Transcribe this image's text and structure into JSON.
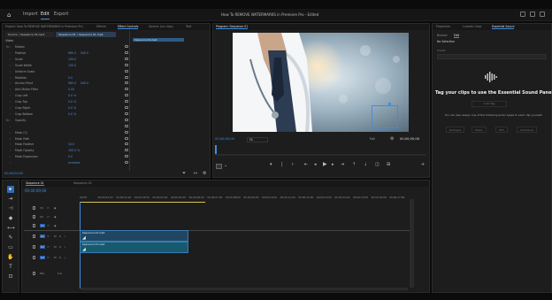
{
  "menu": {
    "home_icon": "home-icon",
    "items": [
      "Import",
      "Edit",
      "Export"
    ],
    "active": "Edit",
    "title": "How To REMOVE WATERMARKS in Premiere Pro - Edited"
  },
  "source_panel": {
    "tabs": [
      "Project: How To REMOVE WATERMARKS in Premiere Pro",
      "Effects",
      "Effect Controls",
      "Source: (no clips)",
      "Text"
    ],
    "source_label": "Source • Sequence 01.mp4",
    "seq_label": "Sequence 01 • Sequence 01.mp4",
    "section_video": "Video",
    "rows": [
      {
        "fx": "fx",
        "label": "Motion",
        "v1": "",
        "v2": ""
      },
      {
        "fx": "",
        "label": "Position",
        "v1": "960.0",
        "v2": "540.0"
      },
      {
        "fx": "",
        "label": "Scale",
        "v1": "100.0",
        "v2": ""
      },
      {
        "fx": "",
        "label": "Scale Width",
        "v1": "100.0",
        "v2": ""
      },
      {
        "fx": "",
        "label": "Uniform Scale",
        "v1": "",
        "v2": ""
      },
      {
        "fx": "",
        "label": "Rotation",
        "v1": "0.0",
        "v2": ""
      },
      {
        "fx": "",
        "label": "Anchor Point",
        "v1": "960.0",
        "v2": "540.0"
      },
      {
        "fx": "",
        "label": "Anti-flicker Filter",
        "v1": "0.00",
        "v2": ""
      },
      {
        "fx": "",
        "label": "Crop Left",
        "v1": "0.0 %",
        "v2": ""
      },
      {
        "fx": "",
        "label": "Crop Top",
        "v1": "0.0 %",
        "v2": ""
      },
      {
        "fx": "",
        "label": "Crop Right",
        "v1": "0.0 %",
        "v2": ""
      },
      {
        "fx": "",
        "label": "Crop Bottom",
        "v1": "0.0 %",
        "v2": ""
      },
      {
        "fx": "fx",
        "label": "Opacity",
        "v1": "",
        "v2": ""
      },
      {
        "fx": "",
        "label": "",
        "v1": "",
        "v2": ""
      },
      {
        "fx": "",
        "label": "Mask (1)",
        "v1": "",
        "v2": ""
      },
      {
        "fx": "",
        "label": "Mask Path",
        "v1": "",
        "v2": ""
      },
      {
        "fx": "",
        "label": "Mask Feather",
        "v1": "10.0",
        "v2": ""
      },
      {
        "fx": "",
        "label": "Mask Opacity",
        "v1": "100.0 %",
        "v2": ""
      },
      {
        "fx": "",
        "label": "Mask Expansion",
        "v1": "0.0",
        "v2": ""
      },
      {
        "fx": "",
        "label": "",
        "v1": "Inverted",
        "v2": ""
      }
    ],
    "clip_label": "Sequence 01.mp4",
    "timecode": "00;00;00;00"
  },
  "program": {
    "title": "Program: Sequence 01",
    "timecode_left": "00;00;00;00",
    "fit": "Fit",
    "quality": "Full",
    "timecode_right": "00;00;00;06"
  },
  "right_panel": {
    "tabs": [
      "Properties",
      "Lumetri Color",
      "Essential Sound"
    ],
    "subtabs": [
      "Browse",
      "Edit"
    ],
    "no_selection": "No Selection",
    "preset_label": "Preset:",
    "heading": "Tag your clips to use the Essential Sound Panel",
    "auto_tag": "Auto-Tag",
    "subtext": "You can also assign one of the following audio types to each clip yourself:",
    "types": [
      "Dialogue",
      "Music",
      "SFX",
      "Ambience"
    ]
  },
  "timeline": {
    "tabs": [
      "Sequence 01",
      "Sequence 02"
    ],
    "timecode": "00;00;00;00",
    "ticks": [
      "00;00",
      "00;00;01;00",
      "00;00;02;00",
      "00;00;03;00",
      "00;00;04;00",
      "00;00;05;00",
      "00;00;06;00",
      "00;00;07;00",
      "00;00;08;00",
      "00;00;09;00",
      "00;00;10;00",
      "00;00;11;00",
      "00;00;12;00",
      "00;00;13;00",
      "00;00;14;00",
      "00;00;15;00",
      "00;00;16;00",
      "00;00;17;00"
    ],
    "tracks": [
      "V3",
      "V2",
      "V1",
      "A1",
      "A2",
      "A3",
      "Mix"
    ],
    "mix_value": "0.0",
    "clip_v1": "Sequence 01.mp4",
    "clip_a1": "Sequence 01.mp4"
  },
  "colors": {
    "accent": "#3d8ee8",
    "clip": "#1d4a6b",
    "bg": "#1d1d1d"
  }
}
